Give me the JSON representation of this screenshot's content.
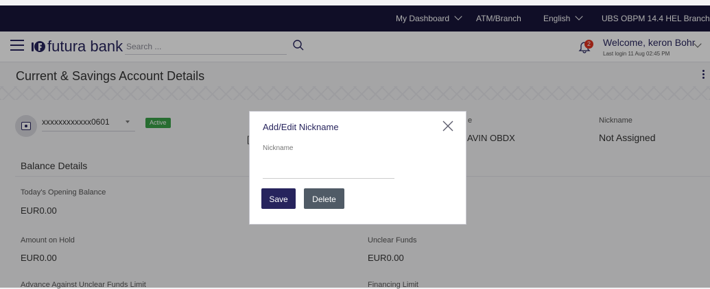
{
  "topbar": {
    "dashboard": "My Dashboard",
    "atm": "ATM/Branch",
    "language": "English",
    "entity": "UBS OBPM 14.4 HEL Branch"
  },
  "header": {
    "brand": "futura bank",
    "search_placeholder": "Search ...",
    "notification_count": "2",
    "welcome": "Welcome, keron Bohr",
    "last_login": "Last login 11 Aug 02:45 PM"
  },
  "page": {
    "title": "Current & Savings Account Details"
  },
  "account": {
    "number": "xxxxxxxxxxxx0601",
    "status": "Active",
    "partial_char": "[",
    "col3_label_partial": "e",
    "col3_value_partial": "AVIN OBDX",
    "nickname_label": "Nickname",
    "nickname_value": "Not Assigned"
  },
  "balance": {
    "section_title": "Balance Details",
    "opening_label": "Today's Opening Balance",
    "opening_value": "EUR0.00",
    "hold_label": "Amount on Hold",
    "hold_value": "EUR0.00",
    "unclear_label": "Unclear Funds",
    "unclear_value": "EUR0.00",
    "advance_label": "Advance Against Unclear Funds Limit",
    "financing_label": "Financing Limit"
  },
  "modal": {
    "title": "Add/Edit Nickname",
    "field_label": "Nickname",
    "field_value": "",
    "save_label": "Save",
    "delete_label": "Delete"
  },
  "colors": {
    "primary": "#27245d",
    "topbar": "#18163a",
    "active_badge": "#3aa149",
    "notification": "#e0331f",
    "delete_button": "#505b66"
  }
}
